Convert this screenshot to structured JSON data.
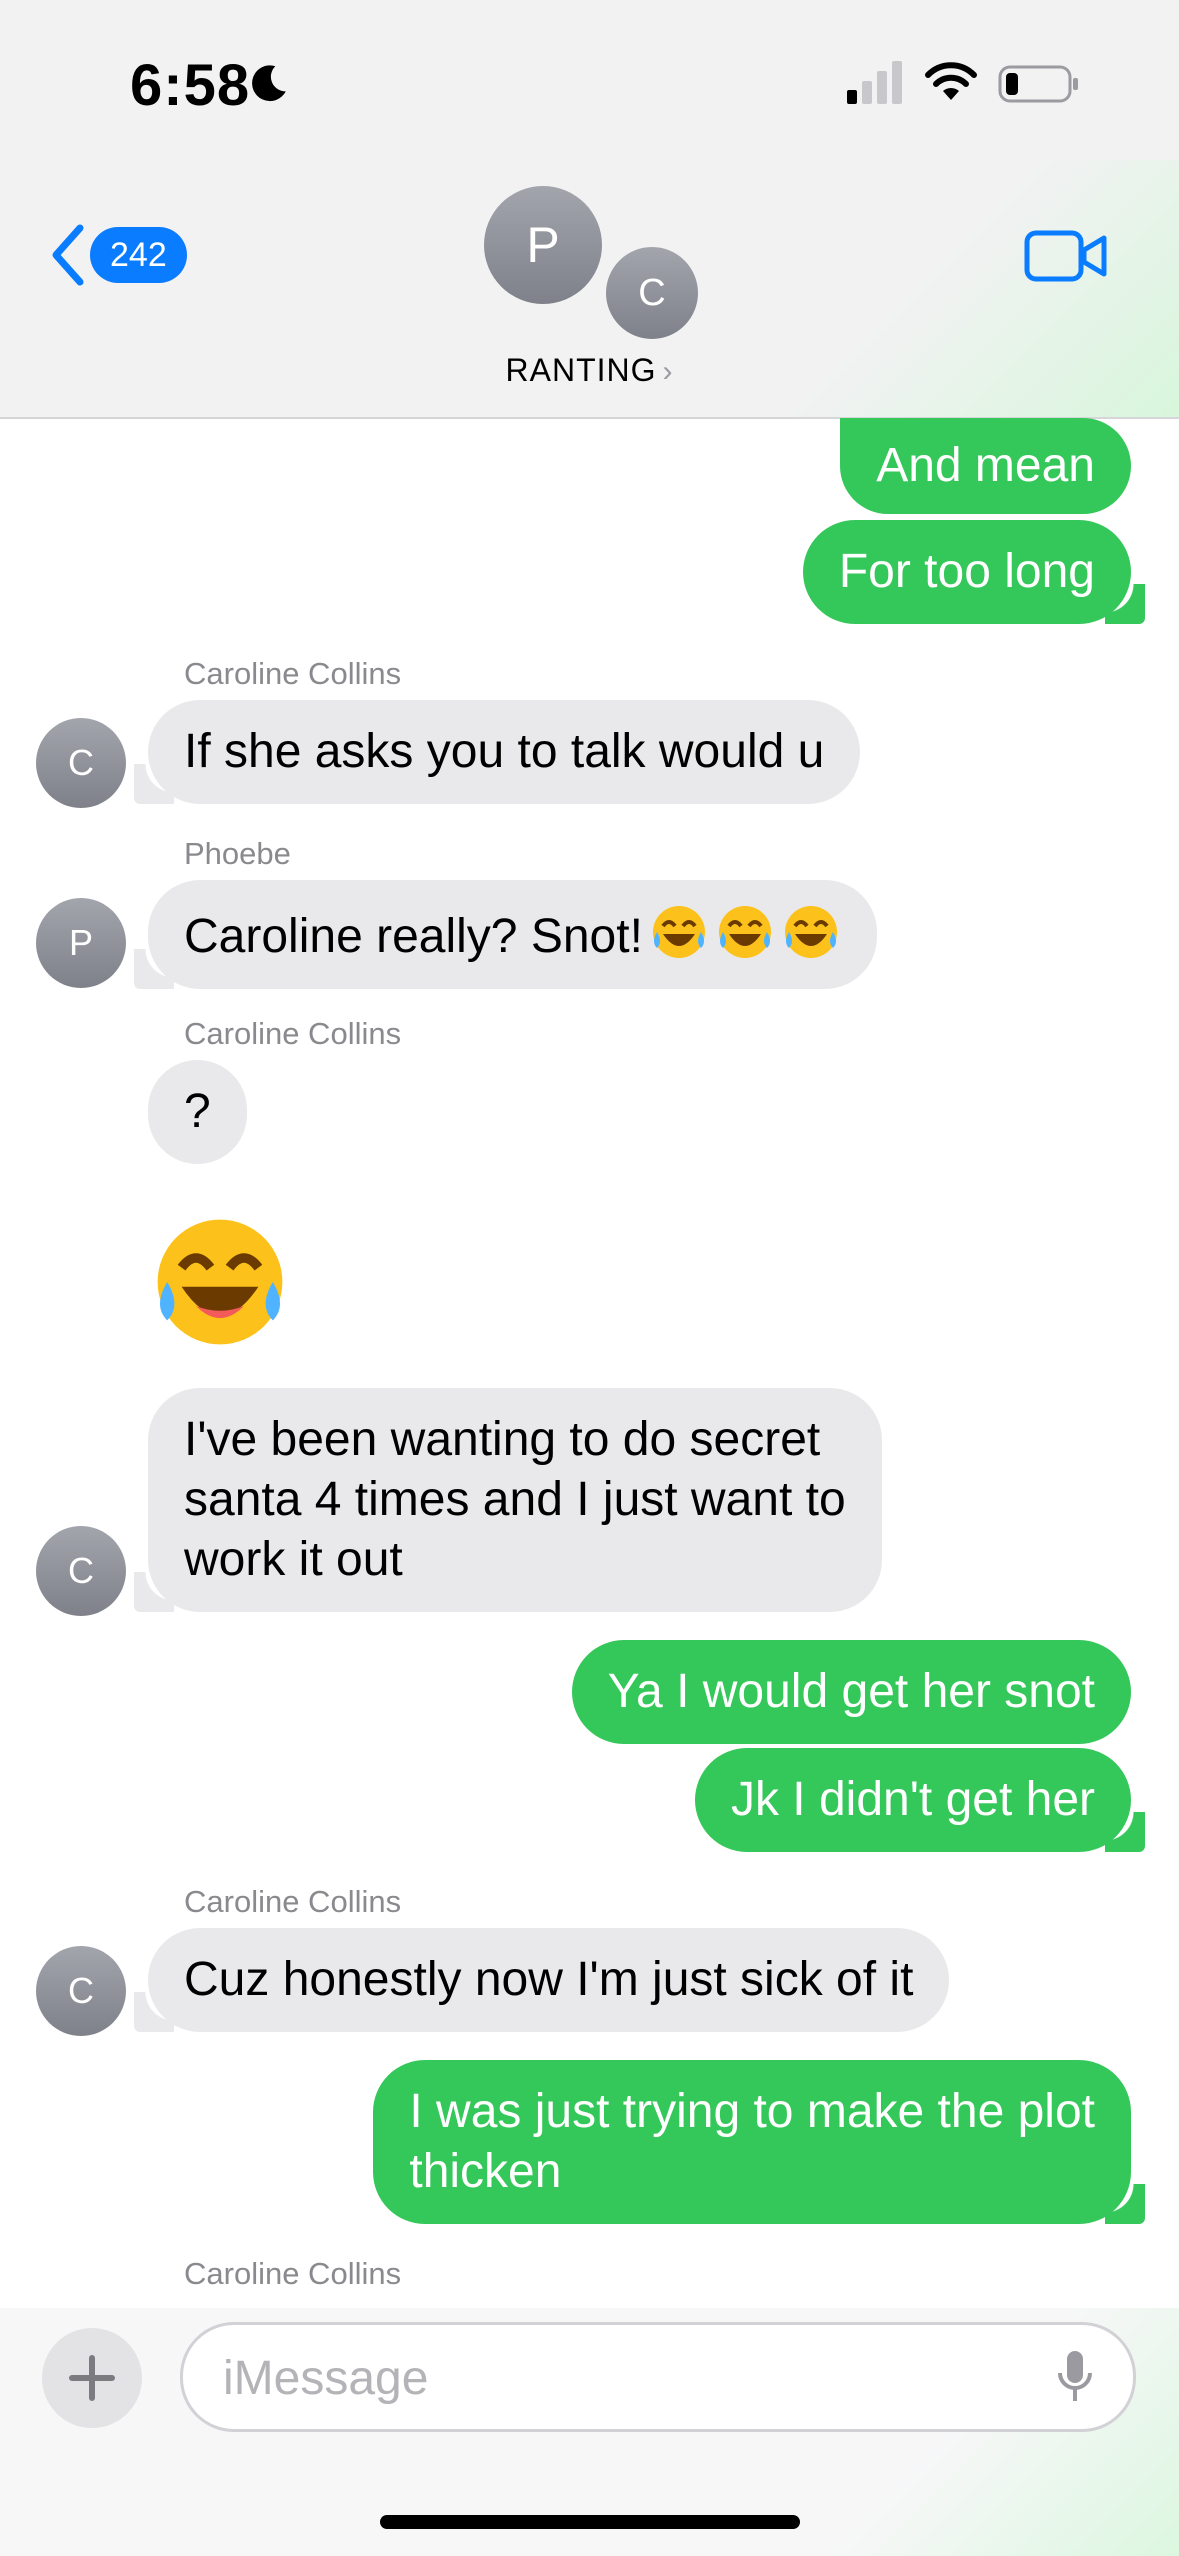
{
  "status_bar": {
    "time": "6:58"
  },
  "header": {
    "back_count": "242",
    "avatar_primary_initial": "P",
    "avatar_secondary_initial": "C",
    "group_name": "RANTING",
    "chevron": "›"
  },
  "messages": [
    {
      "type": "sent",
      "text": "And mean"
    },
    {
      "type": "sent",
      "text": "For too long"
    },
    {
      "type": "received",
      "sender": "Caroline Collins",
      "avatar_initial": "C",
      "text": "If she asks you to talk would u"
    },
    {
      "type": "received",
      "sender": "Phoebe",
      "avatar_initial": "P",
      "text": "Caroline really? Snot!"
    },
    {
      "type": "received",
      "sender": "Caroline Collins",
      "text": "?"
    },
    {
      "type": "received_emoji",
      "emoji": "face-with-tears-of-joy"
    },
    {
      "type": "received",
      "avatar_initial": "C",
      "lines": [
        "I've been wanting to do secret",
        "santa 4 times and I just want to",
        "work it out"
      ]
    },
    {
      "type": "sent",
      "text": "Ya I would get her snot"
    },
    {
      "type": "sent",
      "text": "Jk I didn't get her"
    },
    {
      "type": "received",
      "sender": "Caroline Collins",
      "avatar_initial": "C",
      "text": "Cuz honestly now I'm just sick of it"
    },
    {
      "type": "sent",
      "lines": [
        "I was just trying to make the plot",
        "thicken"
      ]
    },
    {
      "type": "sender_label",
      "sender": "Caroline Collins"
    }
  ],
  "input": {
    "placeholder": "iMessage"
  },
  "colors": {
    "sent_bubble": "#34c759",
    "received_bubble": "#e9e9eb",
    "accent": "#0a7cff"
  },
  "icons": [
    "moon-icon",
    "signal-icon",
    "wifi-icon",
    "battery-icon",
    "back-chevron-icon",
    "video-call-icon",
    "plus-icon",
    "mic-icon",
    "laughing-emoji-icon"
  ]
}
